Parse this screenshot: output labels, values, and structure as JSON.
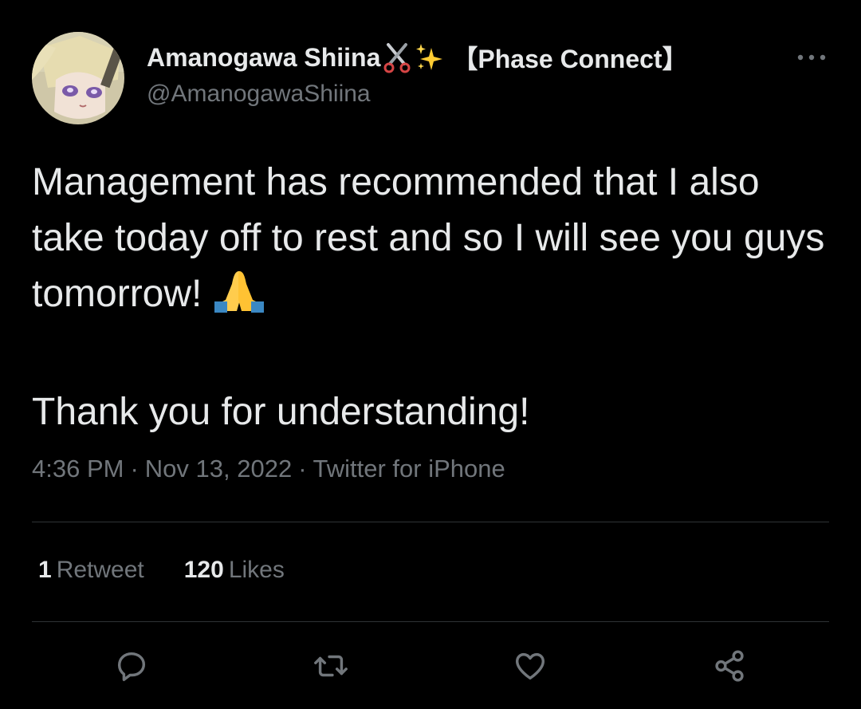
{
  "author": {
    "display_name": "Amanogawa Shiina",
    "name_emojis": [
      "scissors-icon",
      "sparkles-icon"
    ],
    "affiliation": "【Phase Connect】",
    "handle": "@AmanogawaShiina"
  },
  "tweet": {
    "paragraphs": [
      "Management has recommended that I also take today off to rest and so I will see you guys tomorrow!",
      "Thank you for understanding!"
    ],
    "emoji": "folded-hands-icon"
  },
  "meta": {
    "time": "4:36 PM",
    "separator": "·",
    "date": "Nov 13, 2022",
    "source": "Twitter for iPhone"
  },
  "stats": {
    "retweets": {
      "count": "1",
      "label": "Retweet"
    },
    "likes": {
      "count": "120",
      "label": "Likes"
    }
  },
  "actions": [
    "reply-icon",
    "retweet-icon",
    "like-icon",
    "share-icon"
  ],
  "colors": {
    "background": "#000000",
    "primary_text": "#e7e9ea",
    "secondary_text": "#71767b",
    "divider": "#2f3336"
  }
}
